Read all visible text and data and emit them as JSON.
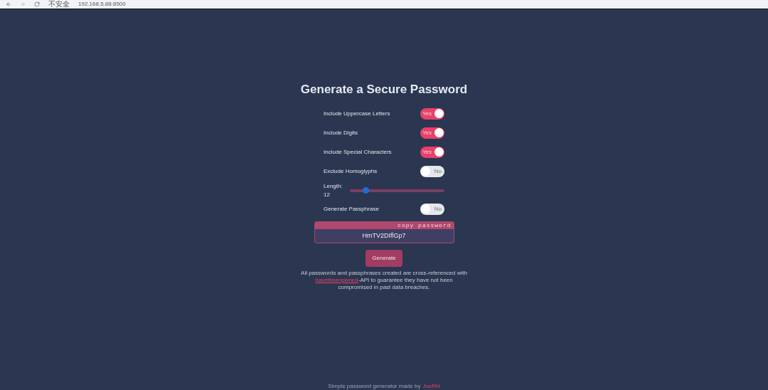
{
  "browser": {
    "security": "不安全",
    "address": "192.168.5.88:8500"
  },
  "title": "Generate a Secure Password",
  "options": [
    {
      "kind": "toggle",
      "label": "Include Uppercase Letters",
      "on": true,
      "switch_text": "Yes"
    },
    {
      "kind": "toggle",
      "label": "Include Digits",
      "on": true,
      "switch_text": "Yes"
    },
    {
      "kind": "toggle",
      "label": "Include Special Characters",
      "on": true,
      "switch_text": "Yes"
    },
    {
      "kind": "toggle",
      "label": "Exclude Homoglyphs",
      "on": false,
      "switch_text": "No"
    },
    {
      "kind": "slider",
      "label": "Length:",
      "reading": "12",
      "level": 0.17
    },
    {
      "kind": "toggle",
      "label": "Generate Passphrase",
      "on": false,
      "switch_text": "No"
    }
  ],
  "password": {
    "copy_label": "copy password",
    "value": "HmTV2DIflGp7"
  },
  "generate_button": "Generate",
  "note": {
    "before": "All passwords and passphrases created are cross-referenced with ",
    "link": "haveibeenpwned",
    "after": "-API to guarantee they have not been compromised in past data breaches."
  },
  "footer": {
    "text": "Simple password generator made by",
    "link": "JooRH"
  }
}
